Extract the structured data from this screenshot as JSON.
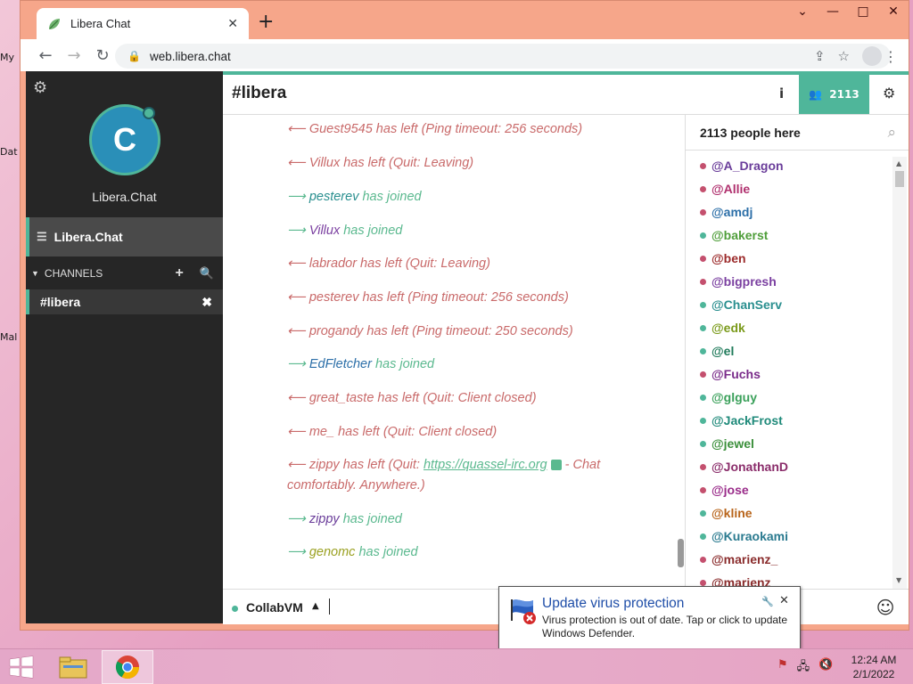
{
  "browser": {
    "tab_title": "Libera Chat",
    "url": "web.libera.chat"
  },
  "sidebar": {
    "network_avatar_letter": "C",
    "network_name": "Libera.Chat",
    "network_row_label": "Libera.Chat",
    "channels_header": "CHANNELS",
    "channels": [
      {
        "name": "#libera"
      }
    ]
  },
  "channel": {
    "title": "#libera",
    "user_count": "2113"
  },
  "messages": [
    {
      "type": "left",
      "arrow": "⟵",
      "nick": "Guest9545",
      "text": " has left (Ping timeout: 256 seconds)"
    },
    {
      "type": "left",
      "arrow": "⟵",
      "nick": "Villux",
      "text": " has left (Quit: Leaving)"
    },
    {
      "type": "join",
      "arrow": "⟶",
      "nick": "pesterev",
      "text": " has joined"
    },
    {
      "type": "join",
      "arrow": "⟶",
      "nick": "Villux",
      "text": " has joined"
    },
    {
      "type": "left",
      "arrow": "⟵",
      "nick": "labrador",
      "text": " has left (Quit: Leaving)"
    },
    {
      "type": "left",
      "arrow": "⟵",
      "nick": "pesterev",
      "text": " has left (Ping timeout: 256 seconds)"
    },
    {
      "type": "left",
      "arrow": "⟵",
      "nick": "progandy",
      "text": " has left (Ping timeout: 250 seconds)"
    },
    {
      "type": "join",
      "arrow": "⟶",
      "nick": "EdFletcher",
      "text": " has joined"
    },
    {
      "type": "left",
      "arrow": "⟵",
      "nick": "great_taste",
      "text": " has left (Quit: Client closed)"
    },
    {
      "type": "left",
      "arrow": "⟵",
      "nick": "me_",
      "text": " has left (Quit: Client closed)"
    },
    {
      "type": "left",
      "arrow": "⟵",
      "nick": "zippy",
      "text": " has left (Quit: ",
      "link": "https://quassel-irc.org",
      "tail": " - Chat comfortably. Anywhere.)"
    },
    {
      "type": "join",
      "arrow": "⟶",
      "nick": "zippy",
      "text": " has joined"
    },
    {
      "type": "join",
      "arrow": "⟶",
      "nick": "genomc",
      "text": " has joined"
    }
  ],
  "userlist": {
    "header": "2113 people here",
    "users": [
      {
        "nick": "@A_Dragon",
        "color": "#6a3d9a"
      },
      {
        "nick": "@Allie",
        "color": "#b0306e"
      },
      {
        "nick": "@amdj",
        "color": "#2c6fa8"
      },
      {
        "nick": "@bakerst",
        "color": "#4f9e3a"
      },
      {
        "nick": "@ben",
        "color": "#9c2b2b"
      },
      {
        "nick": "@bigpresh",
        "color": "#7a3fa0"
      },
      {
        "nick": "@ChanServ",
        "color": "#2a8f8f"
      },
      {
        "nick": "@edk",
        "color": "#7a9a1a"
      },
      {
        "nick": "@el",
        "color": "#1f7a5a"
      },
      {
        "nick": "@Fuchs",
        "color": "#7a2c8a"
      },
      {
        "nick": "@glguy",
        "color": "#3aa05a"
      },
      {
        "nick": "@JackFrost",
        "color": "#1f8a7a"
      },
      {
        "nick": "@jewel",
        "color": "#3a8f3a"
      },
      {
        "nick": "@JonathanD",
        "color": "#8a2c6a"
      },
      {
        "nick": "@jose",
        "color": "#9a2c8a"
      },
      {
        "nick": "@kline",
        "color": "#b8641a"
      },
      {
        "nick": "@Kuraokami",
        "color": "#2a7a8f"
      },
      {
        "nick": "@marienz_",
        "color": "#8a2c2c"
      },
      {
        "nick": "@marienz",
        "color": "#8a2c2c"
      }
    ],
    "dot_colors": [
      "#c4506e",
      "#c4506e",
      "#c4506e",
      "#4fb69a",
      "#c4506e",
      "#c4506e",
      "#4fb69a",
      "#4fb69a",
      "#4fb69a",
      "#c4506e",
      "#4fb69a",
      "#4fb69a",
      "#4fb69a",
      "#c4506e",
      "#c4506e",
      "#4fb69a",
      "#4fb69a",
      "#c4506e",
      "#c4506e"
    ]
  },
  "input": {
    "nick": "CollabVM"
  },
  "notification": {
    "title": "Update virus protection",
    "body": "Virus protection is out of date. Tap or click to update Windows Defender."
  },
  "desktop_icons": [
    {
      "label": "My"
    },
    {
      "label": "Dat"
    },
    {
      "label": "Mal"
    }
  ],
  "taskbar": {
    "time": "12:24 AM",
    "date": "2/1/2022"
  },
  "colors": {
    "accent": "#4fb69a",
    "leave": "#c96a6a",
    "join": "#5bb98f",
    "sidebar": "#262626",
    "window_frame": "#f6a68a"
  }
}
